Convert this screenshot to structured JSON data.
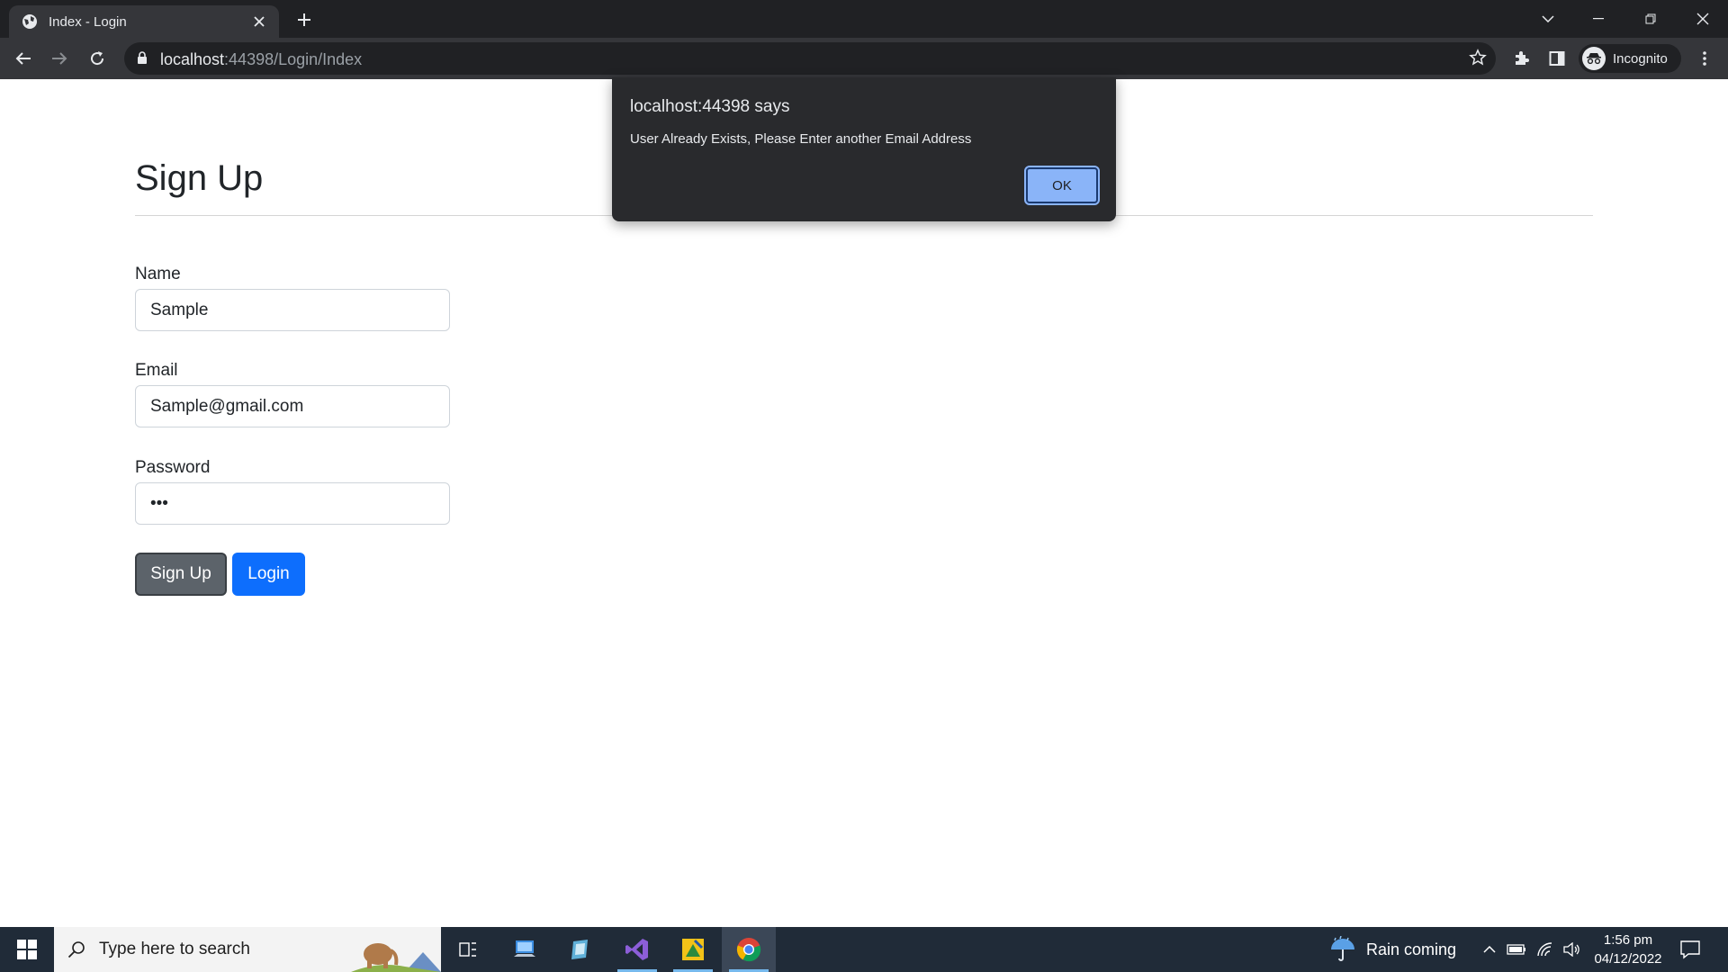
{
  "browser": {
    "tab_title": "Index - Login",
    "url_host": "localhost",
    "url_rest": ":44398/Login/Index",
    "profile_label": "Incognito"
  },
  "page": {
    "heading": "Sign Up",
    "fields": [
      {
        "label": "Name",
        "value": "Sample"
      },
      {
        "label": "Email",
        "value": "Sample@gmail.com"
      },
      {
        "label": "Password",
        "value": "•••"
      }
    ],
    "buttons": {
      "signup": "Sign Up",
      "login": "Login"
    }
  },
  "dialog": {
    "title": "localhost:44398 says",
    "message": "User Already Exists, Please Enter another Email Address",
    "ok_label": "OK"
  },
  "taskbar": {
    "search_placeholder": "Type here to search",
    "weather": "Rain coming",
    "time": "1:56 pm",
    "date": "04/12/2022"
  },
  "colors": {
    "primary": "#0d6efd",
    "secondary": "#5c636a",
    "chrome_dark": "#202124",
    "dialog_ok": "#8ab4f8"
  }
}
